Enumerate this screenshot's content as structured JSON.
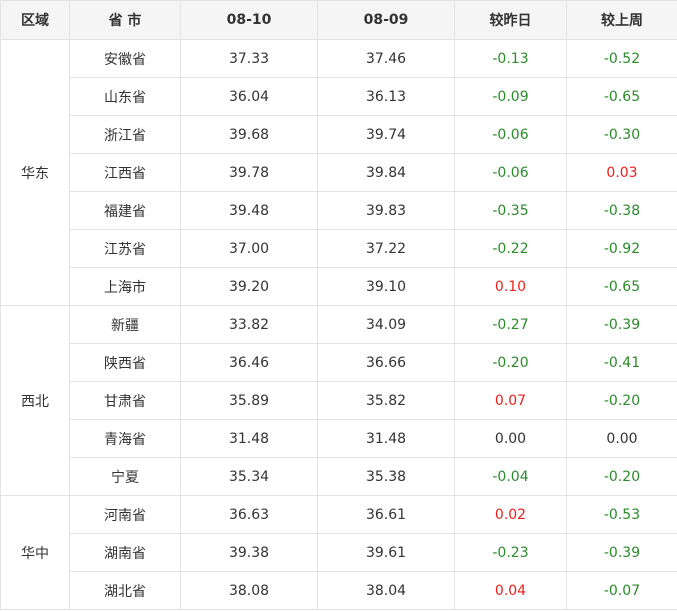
{
  "header": {
    "region": "区域",
    "province": "省 市",
    "date1": "08-10",
    "date2": "08-09",
    "vs_yesterday": "较昨日",
    "vs_last_week": "较上周"
  },
  "colors": {
    "up": "#e8221b",
    "down": "#2b8a2b",
    "flat": "#333333"
  },
  "regions": [
    {
      "name": "华东",
      "rows": [
        {
          "province": "安徽省",
          "d1": "37.33",
          "d2": "37.46",
          "day": "-0.13",
          "week": "-0.52"
        },
        {
          "province": "山东省",
          "d1": "36.04",
          "d2": "36.13",
          "day": "-0.09",
          "week": "-0.65"
        },
        {
          "province": "浙江省",
          "d1": "39.68",
          "d2": "39.74",
          "day": "-0.06",
          "week": "-0.30"
        },
        {
          "province": "江西省",
          "d1": "39.78",
          "d2": "39.84",
          "day": "-0.06",
          "week": "0.03"
        },
        {
          "province": "福建省",
          "d1": "39.48",
          "d2": "39.83",
          "day": "-0.35",
          "week": "-0.38"
        },
        {
          "province": "江苏省",
          "d1": "37.00",
          "d2": "37.22",
          "day": "-0.22",
          "week": "-0.92"
        },
        {
          "province": "上海市",
          "d1": "39.20",
          "d2": "39.10",
          "day": "0.10",
          "week": "-0.65"
        }
      ]
    },
    {
      "name": "西北",
      "rows": [
        {
          "province": "新疆",
          "d1": "33.82",
          "d2": "34.09",
          "day": "-0.27",
          "week": "-0.39"
        },
        {
          "province": "陕西省",
          "d1": "36.46",
          "d2": "36.66",
          "day": "-0.20",
          "week": "-0.41"
        },
        {
          "province": "甘肃省",
          "d1": "35.89",
          "d2": "35.82",
          "day": "0.07",
          "week": "-0.20"
        },
        {
          "province": "青海省",
          "d1": "31.48",
          "d2": "31.48",
          "day": "0.00",
          "week": "0.00"
        },
        {
          "province": "宁夏",
          "d1": "35.34",
          "d2": "35.38",
          "day": "-0.04",
          "week": "-0.20"
        }
      ]
    },
    {
      "name": "华中",
      "rows": [
        {
          "province": "河南省",
          "d1": "36.63",
          "d2": "36.61",
          "day": "0.02",
          "week": "-0.53"
        },
        {
          "province": "湖南省",
          "d1": "39.38",
          "d2": "39.61",
          "day": "-0.23",
          "week": "-0.39"
        },
        {
          "province": "湖北省",
          "d1": "38.08",
          "d2": "38.04",
          "day": "0.04",
          "week": "-0.07"
        }
      ]
    }
  ]
}
